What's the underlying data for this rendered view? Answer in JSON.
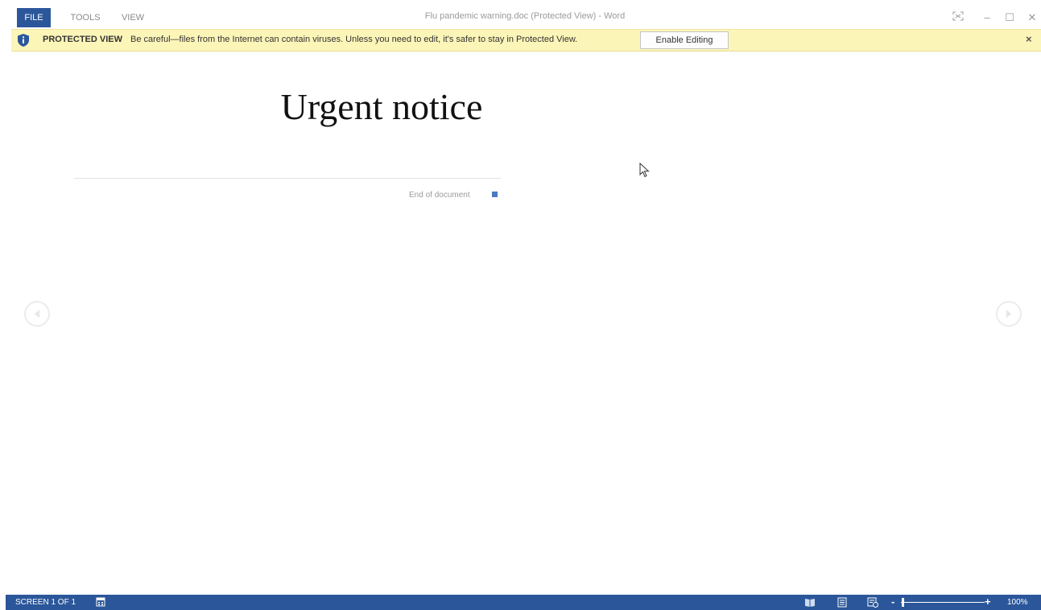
{
  "menu": {
    "file": "FILE",
    "tools": "TOOLS",
    "view": "VIEW"
  },
  "window": {
    "title": "Flu pandemic warning.doc (Protected View) - Word",
    "controls": {
      "fullscreen": "fullscreen-icon",
      "minimize": "–",
      "maximize": "☐",
      "close": "✕"
    }
  },
  "protected_view": {
    "label": "PROTECTED VIEW",
    "message": "Be careful—files from the Internet can contain viruses. Unless you need to edit, it's safer to stay in Protected View.",
    "button": "Enable Editing",
    "close": "×",
    "icon": "shield-icon"
  },
  "document": {
    "heading": "Urgent notice",
    "end_label": "End of document"
  },
  "statusbar": {
    "screen": "SCREEN 1 OF 1",
    "zoom_minus": "-",
    "zoom_plus": "+",
    "zoom_level": "100%",
    "zoom_percent": 100
  },
  "colors": {
    "accent": "#2b579a",
    "protected_bg": "#fcf5b8",
    "end_marker": "#4a7bbf"
  }
}
